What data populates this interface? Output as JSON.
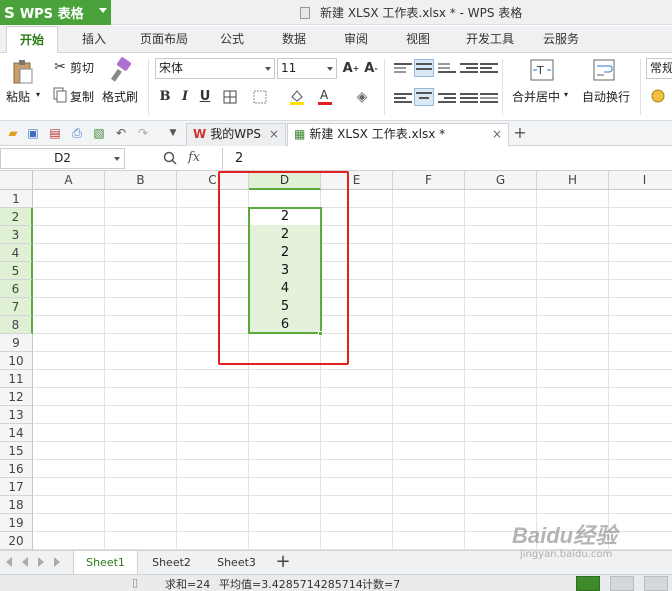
{
  "app": {
    "name": "WPS 表格",
    "logo_letter": "S"
  },
  "window": {
    "title": "新建 XLSX 工作表.xlsx * - WPS 表格"
  },
  "ribbon_tabs": [
    "开始",
    "插入",
    "页面布局",
    "公式",
    "数据",
    "审阅",
    "视图",
    "开发工具",
    "云服务"
  ],
  "active_tab": "开始",
  "ribbon": {
    "paste": "粘贴",
    "cut": "剪切",
    "copy": "复制",
    "format_painter": "格式刷",
    "font_name": "宋体",
    "font_size": "11",
    "bold": "B",
    "italic": "I",
    "underline": "U",
    "merge_center": "合并居中",
    "wrap_text": "自动换行",
    "number_format": "常规"
  },
  "doc_tabs": [
    {
      "label": "我的WPS"
    },
    {
      "label": "新建 XLSX 工作表.xlsx *"
    }
  ],
  "formula_bar": {
    "name_box": "D2",
    "fx": "fx",
    "value": "2"
  },
  "columns": [
    "A",
    "B",
    "C",
    "D",
    "E",
    "F",
    "G",
    "H",
    "I"
  ],
  "rows": [
    "1",
    "2",
    "3",
    "4",
    "5",
    "6",
    "7",
    "8",
    "9",
    "10",
    "11",
    "12",
    "13",
    "14",
    "15",
    "16",
    "17",
    "18",
    "19",
    "20"
  ],
  "cells_D": [
    "2",
    "2",
    "2",
    "3",
    "4",
    "5",
    "6"
  ],
  "sheets": [
    "Sheet1",
    "Sheet2",
    "Sheet3"
  ],
  "active_sheet": "Sheet1",
  "status": {
    "sum": "求和=24",
    "average": "平均值=3.4285714285714",
    "count": "计数=7"
  },
  "watermark": {
    "brand": "Baidu经验",
    "url": "jingyan.baidu.com"
  },
  "colors": {
    "accent_green": "#4aa33a",
    "selection_green": "#5aab3c",
    "highlight_red": "#e32020"
  }
}
